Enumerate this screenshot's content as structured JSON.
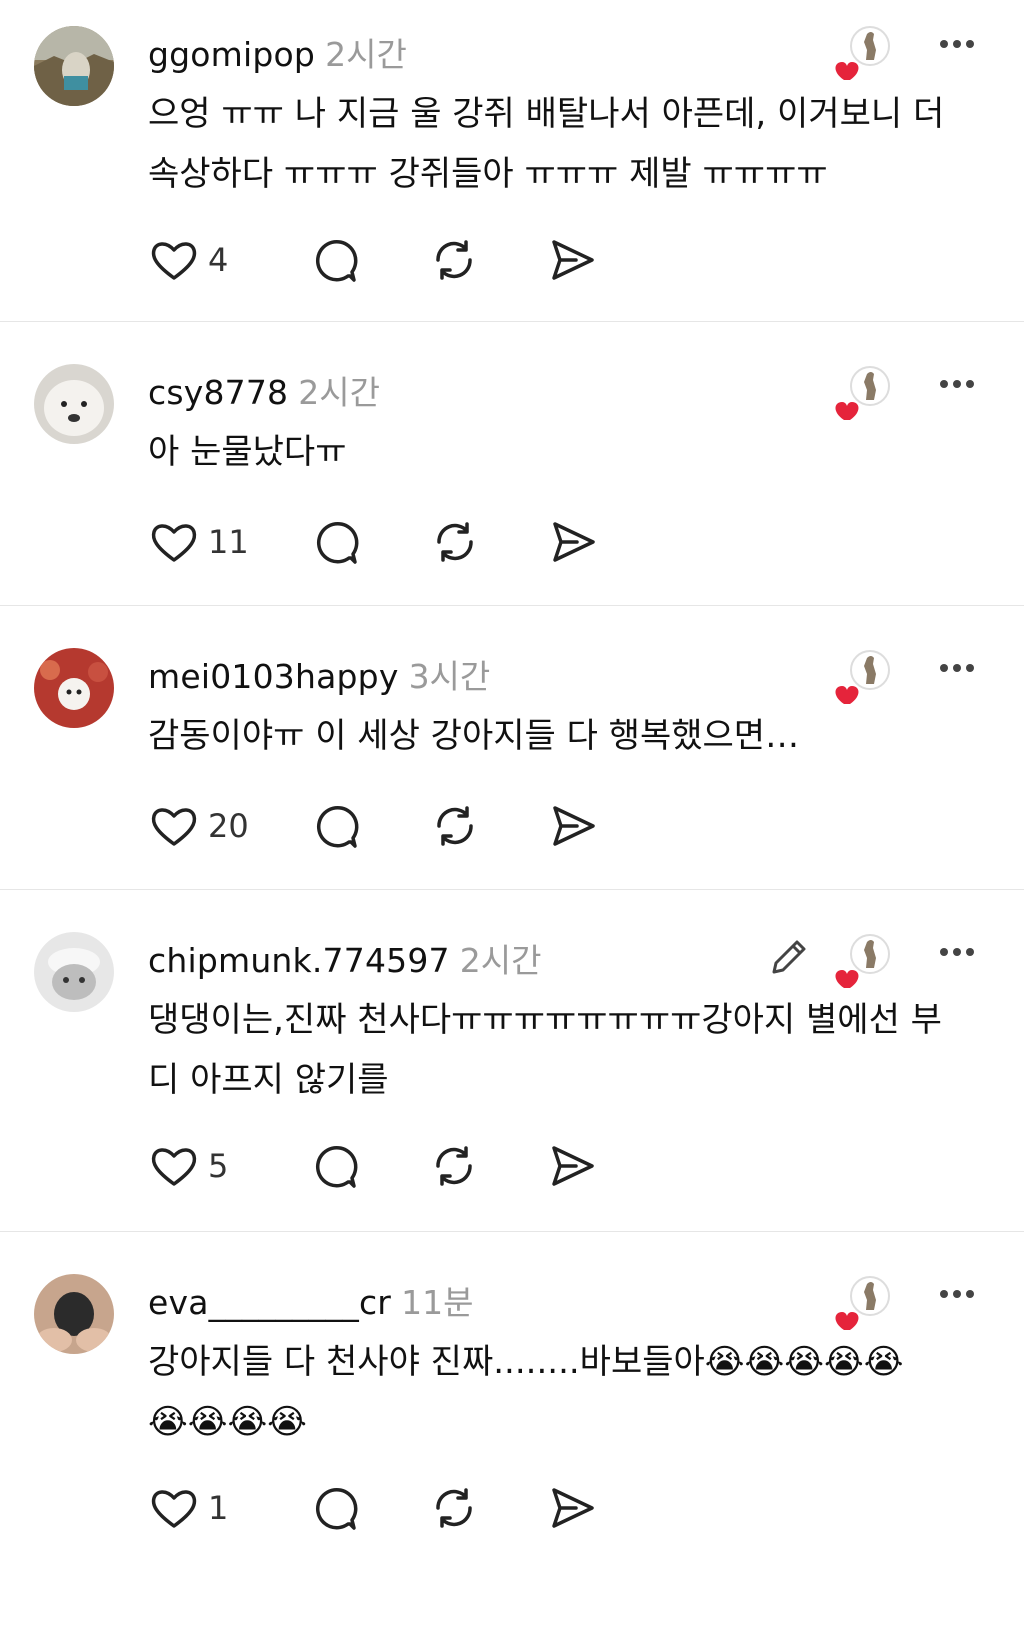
{
  "posts": [
    {
      "username": "ggomipop",
      "time": "2시간",
      "text": "으엉 ㅠㅠ 나 지금 울 강쥐 배탈나서 아픈데, 이거보니 더 속상하다 ㅠㅠㅠ 강쥐들아 ㅠㅠㅠ 제발 ㅠㅠㅠㅠ",
      "likes": "4"
    },
    {
      "username": "csy8778",
      "time": "2시간",
      "text": "아 눈물났다ㅠ",
      "likes": "11"
    },
    {
      "username": "mei0103happy",
      "time": "3시간",
      "text": "감동이야ㅠ 이 세상 강아지들 다 행복했으면…",
      "likes": "20"
    },
    {
      "username": "chipmunk.774597",
      "time": "2시간",
      "text": "댕댕이는,진짜 천사다ㅠㅠㅠㅠㅠㅠㅠㅠ강아지 별에선 부디 아프지 않기를",
      "likes": "5"
    },
    {
      "username": "eva_________cr",
      "time": "11분",
      "text": "강아지들 다 천사야 진짜........바보들아😭😭😭😭😭\n😭😭😭😭",
      "likes": "1"
    }
  ],
  "icons": {
    "like": "heart-outline-icon",
    "reply": "speech-bubble-icon",
    "repost": "repost-arrows-icon",
    "share": "send-arrow-icon",
    "author_liked": "author-liked-heart-icon",
    "more": "more-dots-icon",
    "edit": "pencil-icon"
  },
  "colors": {
    "accent_heart": "#e5243b",
    "muted": "#9a9a9a",
    "divider": "#e6e6e6"
  }
}
